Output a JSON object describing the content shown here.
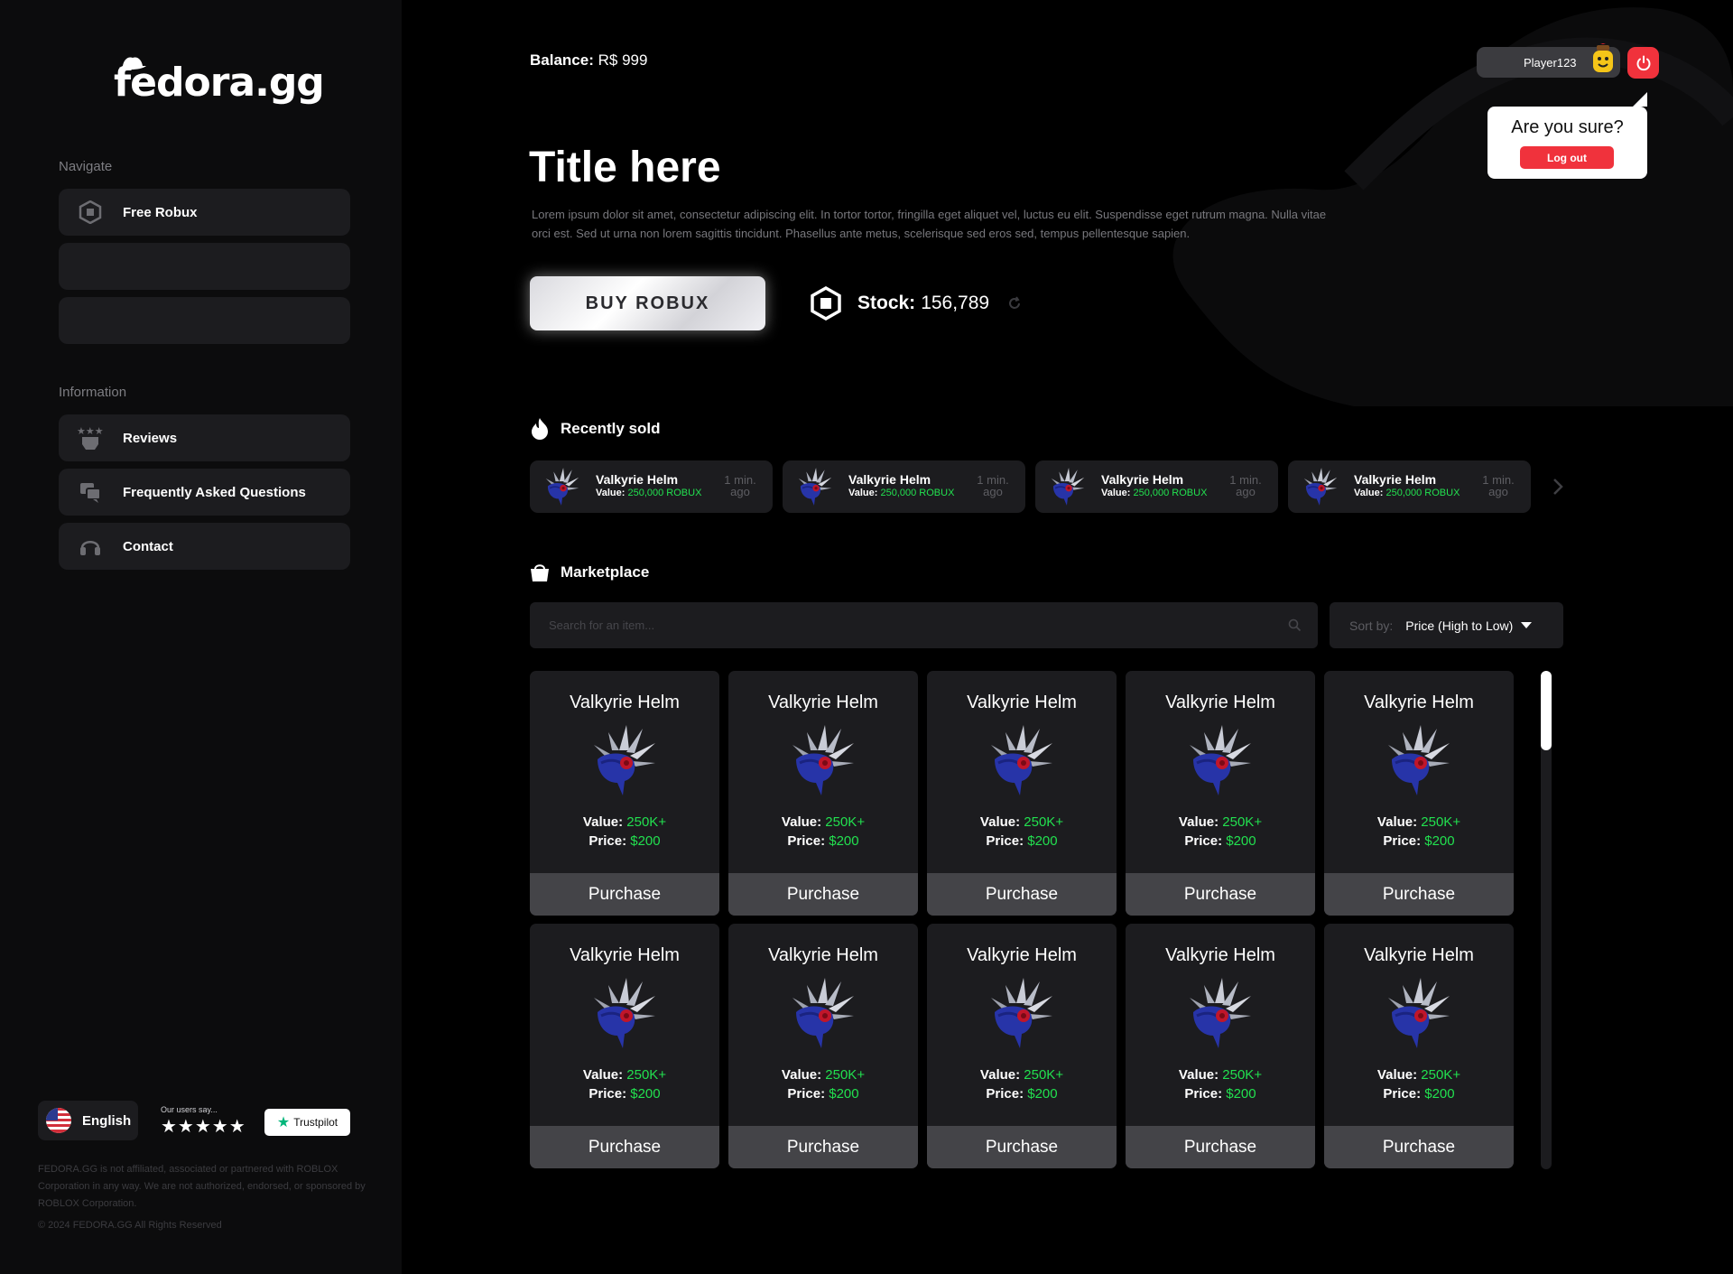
{
  "brand": {
    "name": "fedora.gg"
  },
  "sidebar": {
    "navigate_label": "Navigate",
    "information_label": "Information",
    "nav_items": [
      {
        "label": "Free Robux",
        "icon": "robux-hexagon-icon"
      },
      {
        "label": "",
        "icon": ""
      },
      {
        "label": "",
        "icon": ""
      }
    ],
    "info_items": [
      {
        "label": "Reviews",
        "icon": "reviews-stars-icon"
      },
      {
        "label": "Frequently Asked Questions",
        "icon": "chat-bubbles-icon"
      },
      {
        "label": "Contact",
        "icon": "headset-icon"
      }
    ],
    "language": "English",
    "rating_text": "Our users say...",
    "rating_stars": "★★★★★",
    "trustpilot_label": "Trustpilot",
    "disclaimer": "FEDORA.GG is not affiliated, associated or partnered with ROBLOX Corporation in any way. We are not authorized, endorsed, or sponsored by ROBLOX Corporation.",
    "copyright": "© 2024 FEDORA.GG All Rights Reserved"
  },
  "header": {
    "balance_label": "Balance:",
    "balance_value": "R$ 999",
    "username": "Player123",
    "logout_prompt": "Are you sure?",
    "logout_label": "Log out"
  },
  "hero": {
    "title": "Title here",
    "description": "Lorem ipsum dolor sit amet, consectetur adipiscing elit. In tortor tortor, fringilla eget aliquet vel, luctus eu elit. Suspendisse eget rutrum magna. Nulla vitae orci est. Sed ut urna non lorem sagittis tincidunt. Phasellus ante metus, scelerisque sed eros sed, tempus pellentesque sapien.",
    "buy_label": "BUY ROBUX",
    "stock_label": "Stock:",
    "stock_value": "156,789"
  },
  "recent": {
    "title": "Recently sold",
    "items": [
      {
        "name": "Valkyrie Helm",
        "value_label": "Value:",
        "value": "250,000 ROBUX",
        "time": "1 min. ago"
      },
      {
        "name": "Valkyrie Helm",
        "value_label": "Value:",
        "value": "250,000 ROBUX",
        "time": "1 min. ago"
      },
      {
        "name": "Valkyrie Helm",
        "value_label": "Value:",
        "value": "250,000 ROBUX",
        "time": "1 min. ago"
      },
      {
        "name": "Valkyrie Helm",
        "value_label": "Value:",
        "value": "250,000 ROBUX",
        "time": "1 min. ago"
      }
    ]
  },
  "marketplace": {
    "title": "Marketplace",
    "search_placeholder": "Search for an item...",
    "sort_label": "Sort by:",
    "sort_value": "Price (High to Low)",
    "items": [
      {
        "name": "Valkyrie Helm",
        "value_label": "Value:",
        "value": "250K+",
        "price_label": "Price:",
        "price": "$200",
        "button": "Purchase"
      },
      {
        "name": "Valkyrie Helm",
        "value_label": "Value:",
        "value": "250K+",
        "price_label": "Price:",
        "price": "$200",
        "button": "Purchase"
      },
      {
        "name": "Valkyrie Helm",
        "value_label": "Value:",
        "value": "250K+",
        "price_label": "Price:",
        "price": "$200",
        "button": "Purchase"
      },
      {
        "name": "Valkyrie Helm",
        "value_label": "Value:",
        "value": "250K+",
        "price_label": "Price:",
        "price": "$200",
        "button": "Purchase"
      },
      {
        "name": "Valkyrie Helm",
        "value_label": "Value:",
        "value": "250K+",
        "price_label": "Price:",
        "price": "$200",
        "button": "Purchase"
      },
      {
        "name": "Valkyrie Helm",
        "value_label": "Value:",
        "value": "250K+",
        "price_label": "Price:",
        "price": "$200",
        "button": "Purchase"
      },
      {
        "name": "Valkyrie Helm",
        "value_label": "Value:",
        "value": "250K+",
        "price_label": "Price:",
        "price": "$200",
        "button": "Purchase"
      },
      {
        "name": "Valkyrie Helm",
        "value_label": "Value:",
        "value": "250K+",
        "price_label": "Price:",
        "price": "$200",
        "button": "Purchase"
      },
      {
        "name": "Valkyrie Helm",
        "value_label": "Value:",
        "value": "250K+",
        "price_label": "Price:",
        "price": "$200",
        "button": "Purchase"
      },
      {
        "name": "Valkyrie Helm",
        "value_label": "Value:",
        "value": "250K+",
        "price_label": "Price:",
        "price": "$200",
        "button": "Purchase"
      }
    ]
  },
  "colors": {
    "accent_green": "#22e04f",
    "danger_red": "#f0323c",
    "card_bg": "#1c1c1f",
    "sidebar_bg": "#0c0c0d"
  }
}
